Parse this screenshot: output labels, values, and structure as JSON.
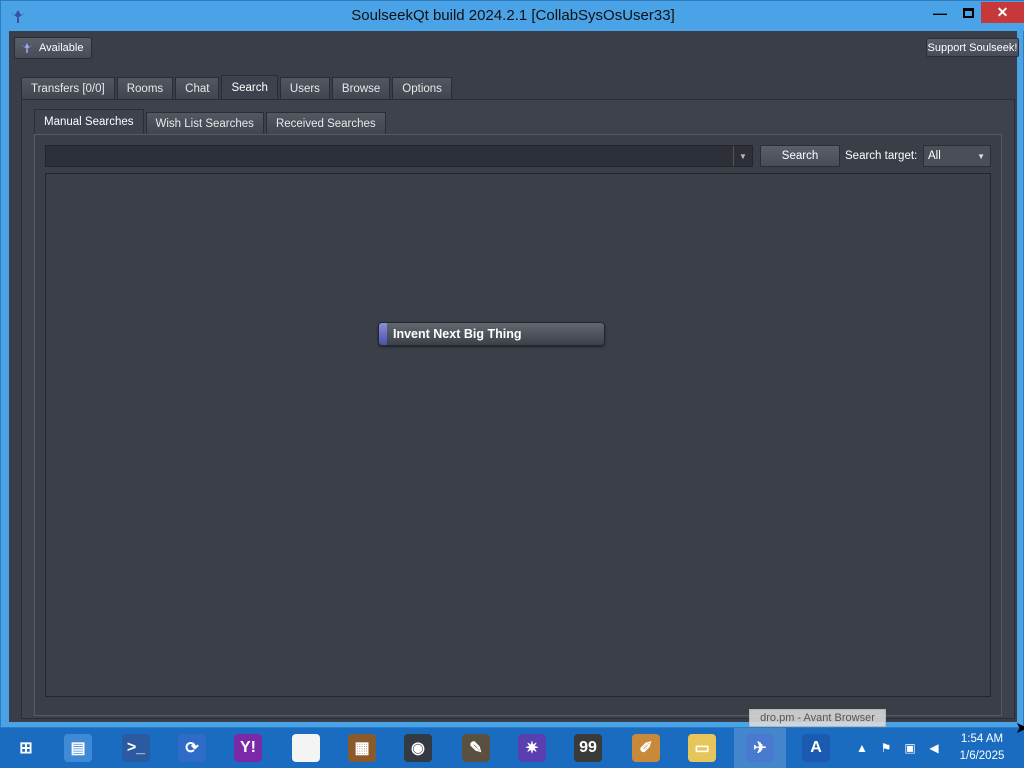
{
  "window": {
    "title": "SoulseekQt build 2024.2.1 [CollabSysOsUser33]",
    "controls": {
      "minimize": "minimize-icon",
      "maximize": "maximize-icon",
      "close": "close-icon"
    }
  },
  "header": {
    "status_label": "Available",
    "support_label": "Support Soulseek!"
  },
  "main_tabs": [
    {
      "label": "Transfers [0/0]"
    },
    {
      "label": "Rooms"
    },
    {
      "label": "Chat"
    },
    {
      "label": "Search",
      "active": true
    },
    {
      "label": "Users"
    },
    {
      "label": "Browse"
    },
    {
      "label": "Options"
    }
  ],
  "sub_tabs": [
    {
      "label": "Manual Searches",
      "active": true
    },
    {
      "label": "Wish List Searches"
    },
    {
      "label": "Received Searches"
    }
  ],
  "search": {
    "query": "",
    "button_label": "Search",
    "target_label": "Search target:",
    "target_value": "All"
  },
  "floating_button": {
    "label": "Invent Next Big Thing"
  },
  "tooltip": {
    "text": "dro.pm - Avant Browser"
  },
  "taskbar": {
    "items": [
      {
        "name": "windows-start-icon",
        "glyph": "⊞",
        "color": "#1a6cc0"
      },
      {
        "name": "server-manager-icon",
        "glyph": "▤",
        "color": "#3e8ad6"
      },
      {
        "name": "powershell-icon",
        "glyph": ">_",
        "color": "#2c5aa0"
      },
      {
        "name": "sync-icon",
        "glyph": "⟳",
        "color": "#2e6cc8"
      },
      {
        "name": "yahoo-messenger-icon",
        "glyph": "Y!",
        "color": "#7a2aa8"
      },
      {
        "name": "document-icon",
        "glyph": "",
        "color": "#f4f4f4"
      },
      {
        "name": "crate-icon",
        "glyph": "▦",
        "color": "#8a5a2a"
      },
      {
        "name": "camera-icon",
        "glyph": "◉",
        "color": "#333a44"
      },
      {
        "name": "gimp-icon",
        "glyph": "✎",
        "color": "#5a5040"
      },
      {
        "name": "virus-icon",
        "glyph": "✷",
        "color": "#5a3fb0"
      },
      {
        "name": "monitor-99-icon",
        "glyph": "99",
        "color": "#3a3a3a"
      },
      {
        "name": "paint-icon",
        "glyph": "✐",
        "color": "#c88a3a"
      },
      {
        "name": "file-explorer-icon",
        "glyph": "▭",
        "color": "#e6c65a"
      },
      {
        "name": "soulseek-icon",
        "glyph": "✈",
        "color": "#4a7ad0"
      },
      {
        "name": "avant-browser-icon",
        "glyph": "A",
        "color": "#1a5ab0"
      }
    ],
    "active_index": 13,
    "tray_icons": [
      "tray-chevron-icon",
      "tray-security-icon",
      "tray-network-icon",
      "tray-volume-icon"
    ],
    "clock_time": "1:54 AM",
    "clock_date": "1/6/2025"
  }
}
